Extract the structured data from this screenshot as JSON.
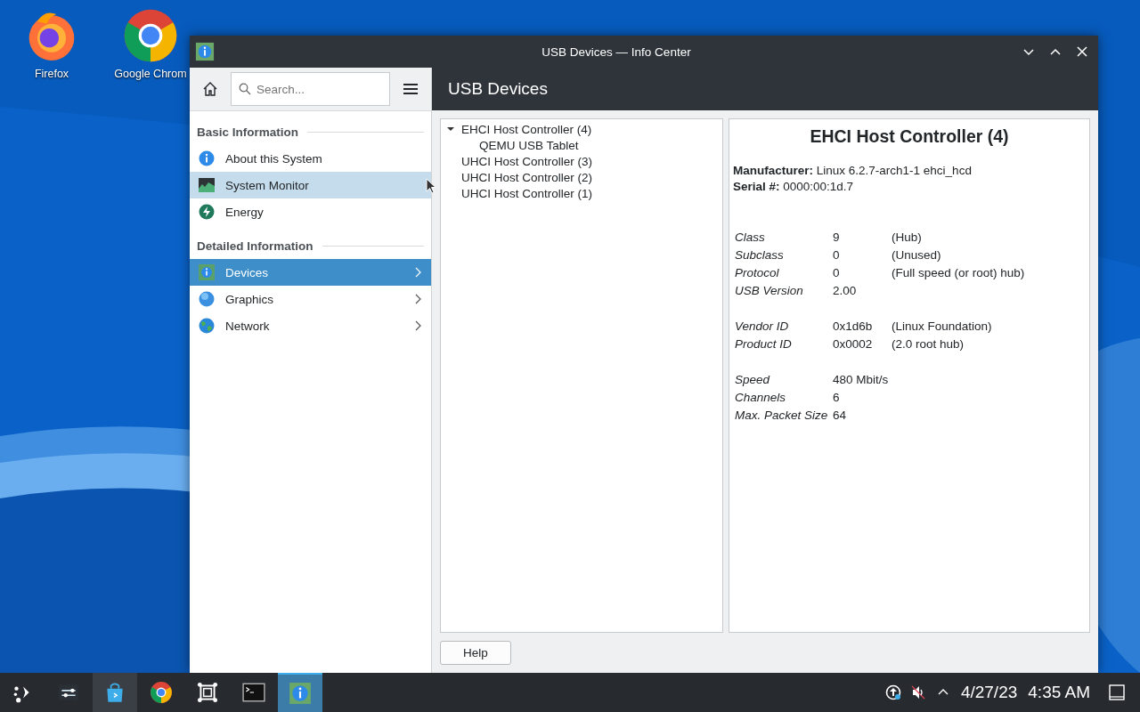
{
  "desktop_icons": [
    {
      "kind": "firefox",
      "label": "Firefox"
    },
    {
      "kind": "chrome",
      "label": "Google Chrom"
    }
  ],
  "window": {
    "title": "USB Devices — Info Center"
  },
  "sidebar": {
    "search": {
      "placeholder": "Search..."
    },
    "sections": [
      {
        "title": "Basic Information",
        "items": [
          {
            "label": "About this System",
            "selected": false,
            "hovered": false,
            "has_children": false
          },
          {
            "label": "System Monitor",
            "selected": false,
            "hovered": true,
            "has_children": false
          },
          {
            "label": "Energy",
            "selected": false,
            "hovered": false,
            "has_children": false
          }
        ]
      },
      {
        "title": "Detailed Information",
        "items": [
          {
            "label": "Devices",
            "selected": true,
            "hovered": false,
            "has_children": true
          },
          {
            "label": "Graphics",
            "selected": false,
            "hovered": false,
            "has_children": true
          },
          {
            "label": "Network",
            "selected": false,
            "hovered": false,
            "has_children": true
          }
        ]
      }
    ]
  },
  "page_title": "USB Devices",
  "tree": [
    {
      "label": "EHCI Host Controller (4)",
      "expanded": true,
      "children": [
        {
          "label": "QEMU USB Tablet"
        }
      ]
    },
    {
      "label": "UHCI Host Controller (3)"
    },
    {
      "label": "UHCI Host Controller (2)"
    },
    {
      "label": "UHCI Host Controller (1)"
    }
  ],
  "details": {
    "title": "EHCI Host Controller (4)",
    "summary": [
      {
        "label": "Manufacturer:",
        "value": "Linux 6.2.7-arch1-1 ehci_hcd"
      },
      {
        "label": "Serial #:",
        "value": "0000:00:1d.7"
      }
    ],
    "groups": [
      [
        {
          "label": "Class",
          "value": "9",
          "note": "(Hub)"
        },
        {
          "label": "Subclass",
          "value": "0",
          "note": "(Unused)"
        },
        {
          "label": "Protocol",
          "value": "0",
          "note": "(Full speed (or root) hub)"
        },
        {
          "label": "USB Version",
          "value": "2.00"
        }
      ],
      [
        {
          "label": "Vendor ID",
          "value": "0x1d6b",
          "note": "(Linux Foundation)"
        },
        {
          "label": "Product ID",
          "value": "0x0002",
          "note": "(2.0 root hub)"
        }
      ],
      [
        {
          "label": "Speed",
          "value": "480 Mbit/s"
        },
        {
          "label": "Channels",
          "value": "6"
        },
        {
          "label": "Max. Packet Size",
          "value": "64"
        }
      ]
    ]
  },
  "help_button": "Help",
  "taskbar": {
    "items": [
      {
        "kind": "launcher",
        "active": false,
        "hovered": false
      },
      {
        "kind": "settings",
        "active": false,
        "hovered": false
      },
      {
        "kind": "store",
        "active": false,
        "hovered": true
      },
      {
        "kind": "chrome",
        "active": false,
        "hovered": false
      },
      {
        "kind": "vm",
        "active": false,
        "hovered": false
      },
      {
        "kind": "terminal",
        "active": false,
        "hovered": false
      },
      {
        "kind": "infocenter",
        "active": true,
        "hovered": false
      }
    ],
    "tray": [
      {
        "kind": "updates"
      },
      {
        "kind": "muted"
      },
      {
        "kind": "expand"
      }
    ],
    "date": "4/27/23",
    "time": "4:35 AM"
  }
}
